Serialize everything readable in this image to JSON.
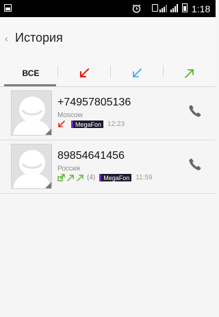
{
  "status_bar": {
    "time": "1:18 pm"
  },
  "header": {
    "title": "История",
    "back_icon": "‹"
  },
  "tabs": [
    {
      "id": "all",
      "label": "ВСЕ",
      "selected": true
    },
    {
      "id": "missed",
      "icon": "missed-call-arrow-icon",
      "color": "#e0201a"
    },
    {
      "id": "incoming",
      "icon": "incoming-call-arrow-icon",
      "color": "#2aa3e6"
    },
    {
      "id": "outgoing",
      "icon": "outgoing-call-arrow-icon",
      "color": "#5ab52a"
    }
  ],
  "calls": [
    {
      "number": "+74957805136",
      "location": "Moscow",
      "type_icons": [
        "missed-call-arrow-icon"
      ],
      "count": "",
      "operator": "MegaFon",
      "time": "12:23"
    },
    {
      "number": "89854641456",
      "location": "Россия",
      "type_icons": [
        "forwarded-call-icon",
        "outgoing-call-arrow-icon",
        "outgoing-call-arrow-icon"
      ],
      "count": "(4)",
      "operator": "MegaFon",
      "time": "11:59"
    }
  ],
  "colors": {
    "missed": "#e0201a",
    "incoming": "#2aa3e6",
    "outgoing": "#5ab52a",
    "operator_badge": "#1e1a2e",
    "operator_accent": "#7a1fd0"
  }
}
